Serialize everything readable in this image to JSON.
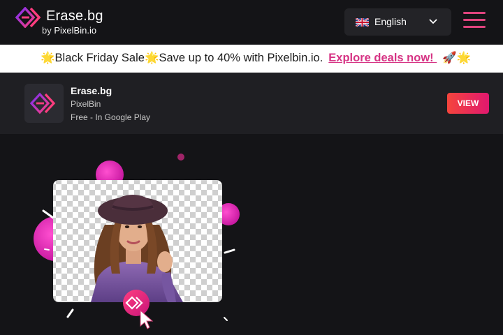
{
  "header": {
    "brand_title": "Erase.bg",
    "brand_by": "by",
    "brand_company": "PixelBin.io",
    "language": "English",
    "icons": {
      "logo": "erasebg-logo-icon",
      "flag": "uk-flag-icon",
      "chevron": "chevron-down-icon",
      "menu": "hamburger-menu-icon"
    }
  },
  "banner": {
    "star1": "🌟",
    "sale_text": "Black Friday Sale",
    "star2": "🌟",
    "offer_text": "Save up to 40% with Pixelbin.io.",
    "link_text": "Explore deals now! ",
    "end_emojis": "🚀🌟"
  },
  "app_promo": {
    "name": "Erase.bg",
    "developer": "PixelBin",
    "price": "Free - In Google Play",
    "button": "VIEW"
  },
  "hero": {
    "image": "woman-in-hat-transparent-background-illustration",
    "badge_icon": "erasebg-logo-icon",
    "cursor_icon": "cursor-arrow-icon"
  },
  "colors": {
    "background": "#141417",
    "accent_pink": "#e0447e",
    "link_pink": "#d63384",
    "button_gradient_start": "#f5453c",
    "button_gradient_end": "#e0186f"
  }
}
